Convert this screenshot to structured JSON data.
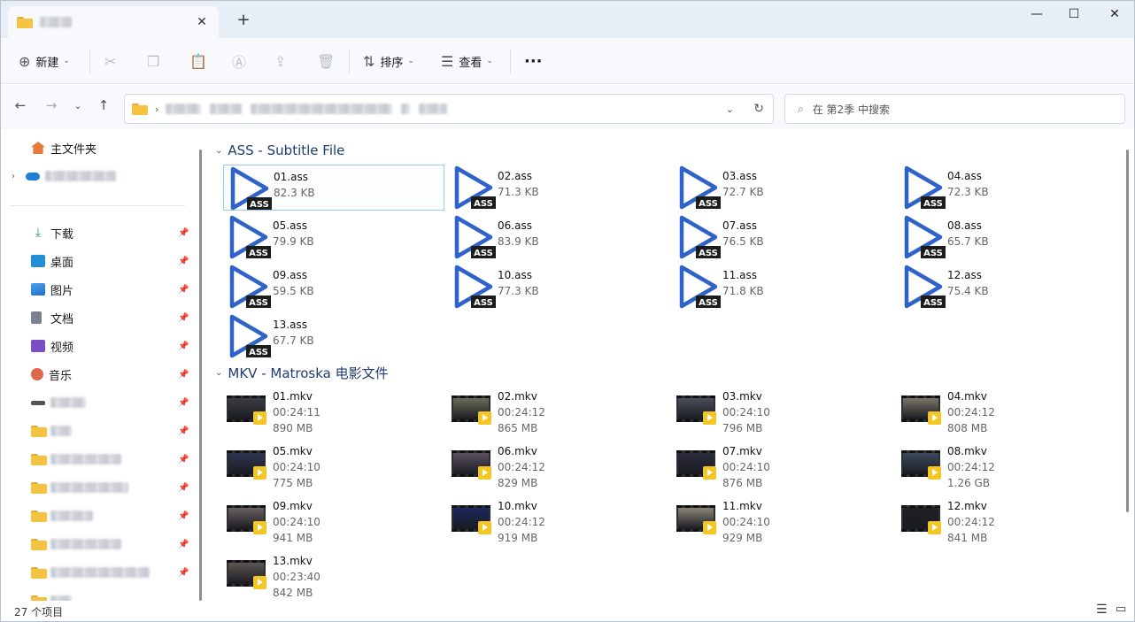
{
  "window": {
    "tab_title_blurred": true,
    "new_tab": "+",
    "tab_close": "✕",
    "controls": {
      "minimize": "—",
      "maximize": "☐",
      "close": "✕"
    }
  },
  "toolbar": {
    "new_label": "新建",
    "sort_label": "排序",
    "view_label": "查看",
    "more": "···"
  },
  "address": {
    "search_placeholder": "在 第2季 中搜索"
  },
  "sidebar": {
    "home": "主文件夹",
    "items": [
      {
        "label": "下载",
        "icon": "download-icon",
        "color": "#2a9d6f"
      },
      {
        "label": "桌面",
        "icon": "desktop-icon",
        "color": "#1f8fd6"
      },
      {
        "label": "图片",
        "icon": "pictures-icon",
        "color": "#2a7fd4"
      },
      {
        "label": "文档",
        "icon": "documents-icon",
        "color": "#6b7480"
      },
      {
        "label": "视频",
        "icon": "videos-icon",
        "color": "#7b4fc4"
      },
      {
        "label": "音乐",
        "icon": "music-icon",
        "color": "#e0664c"
      }
    ]
  },
  "groups": {
    "ass": "ASS - Subtitle File",
    "mkv": "MKV - Matroska 电影文件"
  },
  "ass_files": [
    {
      "name": "01.ass",
      "size": "82.3 KB"
    },
    {
      "name": "02.ass",
      "size": "71.3 KB"
    },
    {
      "name": "03.ass",
      "size": "72.7 KB"
    },
    {
      "name": "04.ass",
      "size": "72.3 KB"
    },
    {
      "name": "05.ass",
      "size": "79.9 KB"
    },
    {
      "name": "06.ass",
      "size": "83.9 KB"
    },
    {
      "name": "07.ass",
      "size": "76.5 KB"
    },
    {
      "name": "08.ass",
      "size": "65.7 KB"
    },
    {
      "name": "09.ass",
      "size": "59.5 KB"
    },
    {
      "name": "10.ass",
      "size": "77.3 KB"
    },
    {
      "name": "11.ass",
      "size": "71.8 KB"
    },
    {
      "name": "12.ass",
      "size": "75.4 KB"
    },
    {
      "name": "13.ass",
      "size": "67.7 KB"
    }
  ],
  "ass_badge": "ASS",
  "mkv_files": [
    {
      "name": "01.mkv",
      "duration": "00:24:11",
      "size": "890 MB",
      "tint": "#3a3d46"
    },
    {
      "name": "02.mkv",
      "duration": "00:24:12",
      "size": "865 MB",
      "tint": "#6b6e5a"
    },
    {
      "name": "03.mkv",
      "duration": "00:24:10",
      "size": "796 MB",
      "tint": "#4a4e5c"
    },
    {
      "name": "04.mkv",
      "duration": "00:24:12",
      "size": "808 MB",
      "tint": "#7a7568"
    },
    {
      "name": "05.mkv",
      "duration": "00:24:10",
      "size": "775 MB",
      "tint": "#2e3550"
    },
    {
      "name": "06.mkv",
      "duration": "00:24:12",
      "size": "829 MB",
      "tint": "#5a5060"
    },
    {
      "name": "07.mkv",
      "duration": "00:24:10",
      "size": "876 MB",
      "tint": "#2a2c3c"
    },
    {
      "name": "08.mkv",
      "duration": "00:24:12",
      "size": "1.26 GB",
      "tint": "#3c4a5c"
    },
    {
      "name": "09.mkv",
      "duration": "00:24:10",
      "size": "941 MB",
      "tint": "#6a6060"
    },
    {
      "name": "10.mkv",
      "duration": "00:24:12",
      "size": "919 MB",
      "tint": "#1c2860"
    },
    {
      "name": "11.mkv",
      "duration": "00:24:10",
      "size": "929 MB",
      "tint": "#8a8478"
    },
    {
      "name": "12.mkv",
      "duration": "00:24:12",
      "size": "841 MB",
      "tint": "#202226"
    },
    {
      "name": "13.mkv",
      "duration": "00:23:40",
      "size": "842 MB",
      "tint": "#5c5650"
    }
  ],
  "status": {
    "count": "27 个项目"
  }
}
